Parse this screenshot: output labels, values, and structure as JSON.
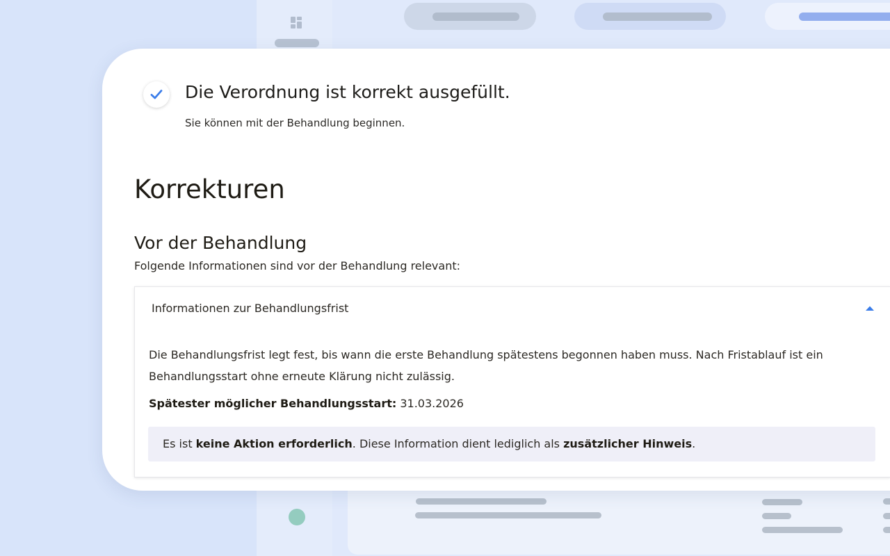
{
  "status": {
    "title": "Die Verordnung ist korrekt ausgefüllt.",
    "subtitle": "Sie können mit der Behandlung beginnen.",
    "icon": "check-icon",
    "icon_color": "#3b7de9"
  },
  "section": {
    "title": "Korrekturen"
  },
  "subsection": {
    "title": "Vor der Behandlung",
    "description": "Folgende Informationen sind vor der Behandlung relevant:"
  },
  "accordion": {
    "title": "Informationen zur Behandlungsfrist",
    "expanded": true,
    "chevron_icon": "chevron-up-icon",
    "body": "Die Behandlungsfrist legt fest, bis wann die erste Behandlung spätestens begonnen haben muss. Nach Fristablauf ist ein Behandlungsstart ohne erneute Klärung nicht zulässig.",
    "deadline_label": "Spätester möglicher Behandlungsstart:",
    "deadline_value": "31.03.2026",
    "info": {
      "prefix": "Es ist ",
      "bold1": "keine Aktion erforderlich",
      "middle": ". Diese Information dient lediglich als ",
      "bold2": "zusätzlicher Hinweis",
      "suffix": "."
    }
  },
  "colors": {
    "background": "#d8e4fa",
    "card": "#ffffff",
    "info_box": "#efeff8",
    "accent": "#3b7de9"
  }
}
